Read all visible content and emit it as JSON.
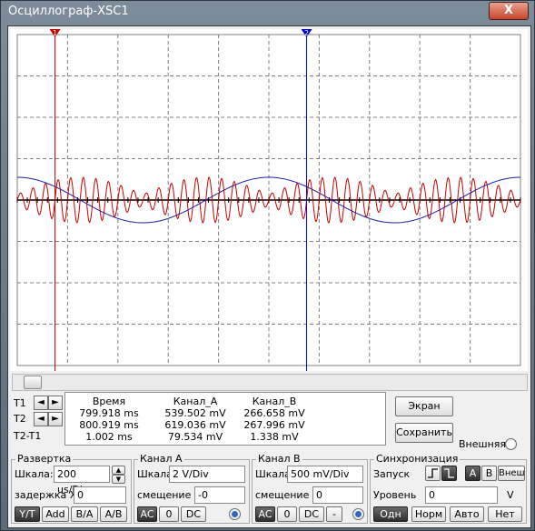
{
  "window": {
    "title": "Осциллограф-XSC1",
    "close_glyph": "X"
  },
  "colors": {
    "grid_bg": "#ffffff",
    "grid_line": "#808080",
    "channel_a": "#c80000",
    "channel_b": "#2020a0",
    "cursor_1": "#cc0000",
    "cursor_2": "#0000cc",
    "axis": "#000000"
  },
  "cursors": {
    "t1_label": "1",
    "t2_label": "2",
    "t1_x_div": 0.75,
    "t2_x_div": 5.75
  },
  "chart_data": {
    "type": "line",
    "x_divisions": 10,
    "y_divisions": 8,
    "series": [
      {
        "name": "Канал_A",
        "waveform": "sine",
        "amplitude_div": 0.55,
        "cycles_visible": 2.0,
        "phase_deg": 90
      },
      {
        "name": "Канал_B",
        "waveform": "modulated sine",
        "amplitude_div": 0.55,
        "carrier_cycles": 40,
        "envelope_cycles": 4
      }
    ]
  },
  "readout": {
    "row_t1": "T1",
    "row_t2": "T2",
    "row_diff": "T2-T1",
    "headers": [
      "Время",
      "Канал_A",
      "Канал_B"
    ],
    "rows": [
      [
        "799.918 ms",
        "539.502 mV",
        "266.658 mV"
      ],
      [
        "800.919 ms",
        "619.036 mV",
        "267.996 mV"
      ],
      [
        "1.002 ms",
        "79.534 mV",
        "1.338 mV"
      ]
    ],
    "arrow_left": "◄",
    "arrow_right": "►"
  },
  "buttons": {
    "screen": "Экран",
    "save": "Сохранить",
    "external": "Внешняя"
  },
  "timebase": {
    "group": "Развертка",
    "scale_label": "Шкала:",
    "scale_value": "200 us/Div",
    "delay_label": "задержка X",
    "delay_value": "0",
    "modes": [
      "Y/T",
      "Add",
      "B/A",
      "A/B"
    ]
  },
  "channel_a": {
    "group": "Канал A",
    "scale_label": "Шкала",
    "scale_value": "2  V/Div",
    "offset_label": "смещение Y",
    "offset_value": "-0",
    "coupling": [
      "AC",
      "0",
      "DC"
    ]
  },
  "channel_b": {
    "group": "Канал B",
    "scale_label": "Шкала",
    "scale_value": "500 mV/Div",
    "offset_label": "смещение Y",
    "offset_value": "0",
    "coupling": [
      "AC",
      "0",
      "DC",
      "-"
    ]
  },
  "trigger": {
    "group": "Синхронизация",
    "edge_label": "Запуск",
    "source_buttons": [
      "A",
      "B",
      "Внеш"
    ],
    "level_label": "Уровень",
    "level_value": "0",
    "level_unit": "V",
    "modes": [
      "Одн",
      "Норм",
      "Авто",
      "Нет"
    ]
  }
}
